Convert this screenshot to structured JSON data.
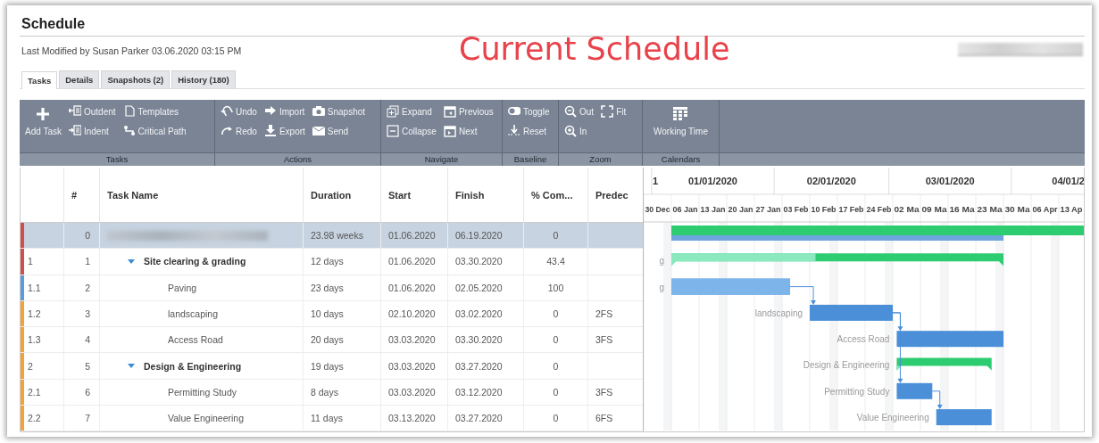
{
  "page": {
    "title": "Schedule",
    "modified": "Last Modified by Susan Parker 03.06.2020 03:15 PM",
    "banner": "Current Schedule"
  },
  "tabs": [
    {
      "label": "Tasks",
      "selected": true
    },
    {
      "label": "Details",
      "selected": false
    },
    {
      "label": "Snapshots (2)",
      "selected": false
    },
    {
      "label": "History (180)",
      "selected": false
    }
  ],
  "toolbar": [
    {
      "label": "Tasks",
      "columns": [
        [
          {
            "label": "Add Task",
            "kind": "add"
          }
        ],
        [
          {
            "label": "Outdent",
            "kind": "outdent"
          },
          {
            "label": "Indent",
            "kind": "indent"
          }
        ],
        [
          {
            "label": "Templates",
            "kind": "templates"
          },
          {
            "label": "Critical Path",
            "kind": "critical"
          }
        ]
      ]
    },
    {
      "label": "Actions",
      "columns": [
        [
          {
            "label": "Undo",
            "kind": "undo"
          },
          {
            "label": "Redo",
            "kind": "redo"
          }
        ],
        [
          {
            "label": "Import",
            "kind": "import"
          },
          {
            "label": "Export",
            "kind": "export"
          }
        ],
        [
          {
            "label": "Snapshot",
            "kind": "snapshot"
          },
          {
            "label": "Send",
            "kind": "send"
          }
        ]
      ]
    },
    {
      "label": "Navigate",
      "columns": [
        [
          {
            "label": "Expand",
            "kind": "expand"
          },
          {
            "label": "Collapse",
            "kind": "collapse"
          }
        ],
        [
          {
            "label": "Previous",
            "kind": "previous"
          },
          {
            "label": "Next",
            "kind": "next"
          }
        ]
      ]
    },
    {
      "label": "Baseline",
      "columns": [
        [
          {
            "label": "Toggle",
            "kind": "toggle"
          },
          {
            "label": "Reset",
            "kind": "reset"
          }
        ]
      ]
    },
    {
      "label": "Zoom",
      "columns": [
        [
          {
            "label": "Out",
            "kind": "zoomout"
          },
          {
            "label": "In",
            "kind": "zoomin"
          }
        ],
        [
          {
            "label": "Fit",
            "kind": "fit"
          }
        ]
      ]
    },
    {
      "label": "Calendars",
      "columns": [
        [
          {
            "label": "Working Time",
            "kind": "calendar"
          }
        ]
      ]
    }
  ],
  "table": {
    "columns": [
      "#",
      "Task Name",
      "Duration",
      "Start",
      "Finish",
      "% Com...",
      "Predec"
    ],
    "rows": [
      {
        "num": "0",
        "kind": "project",
        "selected": true,
        "color": "#c9524e",
        "duration": "23.98 weeks",
        "start": "01.06.2020",
        "finish": "06.19.2020",
        "complete": "0",
        "children": [
          {
            "wbs": "1",
            "num": "1",
            "name": "Site clearing & grading",
            "kind": "summary",
            "expanded": true,
            "selected": false,
            "color": "#c9524e",
            "duration": "12 days",
            "start": "01.06.2020",
            "finish": "03.30.2020",
            "complete": "43.4",
            "gantt_label": "g",
            "children": [
              {
                "wbs": "1.1",
                "num": "2",
                "name": "Paving",
                "kind": "task",
                "selected": false,
                "color": "#5b9bdc",
                "duration": "23 days",
                "start": "01.06.2020",
                "finish": "02.05.2020",
                "complete": "100",
                "gantt_label": "g"
              },
              {
                "wbs": "1.2",
                "num": "3",
                "name": "landscaping",
                "kind": "task",
                "selected": false,
                "color": "#f0a23c",
                "duration": "10 days",
                "start": "02.10.2020",
                "finish": "03.02.2020",
                "complete": "0",
                "predecessor": "2FS",
                "gantt_label": "landscaping"
              },
              {
                "wbs": "1.3",
                "num": "4",
                "name": "Access Road",
                "kind": "task",
                "selected": false,
                "color": "#f0a23c",
                "duration": "20 days",
                "start": "03.03.2020",
                "finish": "03.30.2020",
                "complete": "0",
                "predecessor": "3FS",
                "gantt_label": "Access Road"
              }
            ]
          },
          {
            "wbs": "2",
            "num": "5",
            "name": "Design & Engineering",
            "kind": "summary",
            "expanded": true,
            "selected": false,
            "color": "#f0a23c",
            "duration": "19 days",
            "start": "03.03.2020",
            "finish": "03.27.2020",
            "complete": "0",
            "gantt_label": "Design & Engineering",
            "children": [
              {
                "wbs": "2.1",
                "num": "6",
                "name": "Permitting Study",
                "kind": "task",
                "selected": false,
                "color": "#f0a23c",
                "duration": "8 days",
                "start": "03.03.2020",
                "finish": "03.12.2020",
                "complete": "0",
                "predecessor": "3FS",
                "gantt_label": "Permitting Study"
              },
              {
                "wbs": "2.2",
                "num": "7",
                "name": "Value Engineering",
                "kind": "task",
                "selected": false,
                "color": "#f0a23c",
                "duration": "11 days",
                "start": "03.13.2020",
                "finish": "03.27.2020",
                "complete": "0",
                "predecessor": "6FS",
                "gantt_label": "Value Engineering"
              }
            ]
          }
        ]
      }
    ]
  },
  "gantt": {
    "months": [
      "1",
      "01/01/2020",
      "02/01/2020",
      "03/01/2020",
      "04/01/2"
    ],
    "weeks": [
      "30 Dec",
      "06 Jan",
      "13 Jan",
      "20 Jan",
      "27 Jan",
      "03 Feb",
      "10 Feb",
      "17 Feb",
      "24 Feb",
      "02 Ma",
      "09 Ma",
      "16 Ma",
      "23 Ma",
      "30 Ma",
      "06 Apr",
      "13 Ap"
    ]
  }
}
